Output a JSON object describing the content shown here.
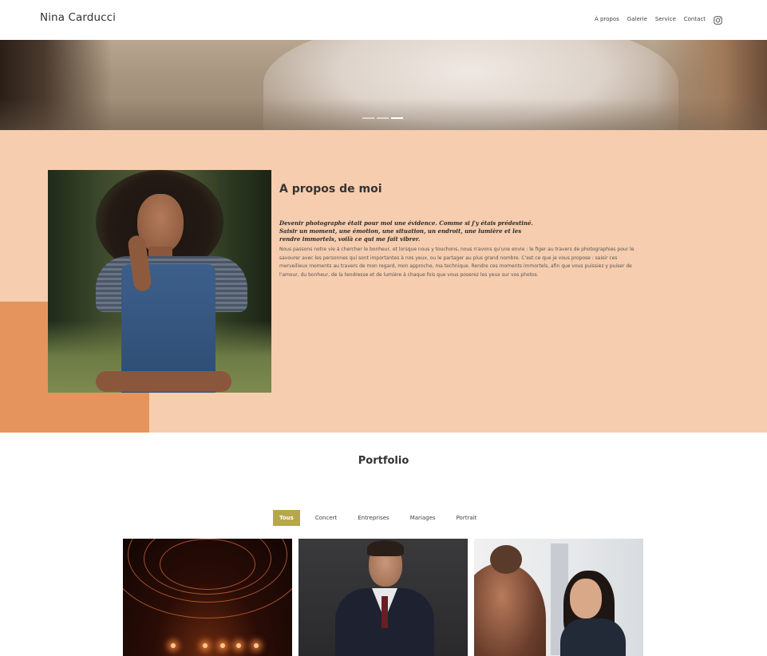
{
  "header": {
    "brand": "Nina Carducci",
    "nav": [
      "À propos",
      "Galerie",
      "Service",
      "Contact"
    ],
    "instagram_icon": "instagram-icon"
  },
  "hero": {
    "slides_count": 3,
    "active_slide": 3
  },
  "about": {
    "title": "A propos de moi",
    "quote": "Devenir photographe était pour moi une évidence. Comme si j'y étais prédestiné. Saisir un moment, une émotion, une situation, un endroit, une lumière et les rendre immortels, voilà ce qui me fait vibrer.",
    "text": "Nous passons notre vie à chercher le bonheur, et lorsque nous y touchons, nous n'avons qu'une envie : le figer au travers de photographies pour le savourer avec les personnes qui sont importantes à nos yeux, ou le partager au plus grand nombre. C'est ce que je vous propose : saisir ces merveilleux moments au travers de mon regard, mon approche, ma technique. Rendre ces moments immortels, afin que vous puissiez y puiser de l'amour, du bonheur, de la tendresse et de lumière à chaque fois que vous poserez les yeux sur vos photos.",
    "colors": {
      "background": "#f6cdae",
      "accent": "#e4945c"
    }
  },
  "portfolio": {
    "title": "Portfolio",
    "filters": [
      "Tous",
      "Concert",
      "Entreprises",
      "Mariages",
      "Portrait"
    ],
    "active_filter": "Tous",
    "active_color": "#b6a84a"
  }
}
